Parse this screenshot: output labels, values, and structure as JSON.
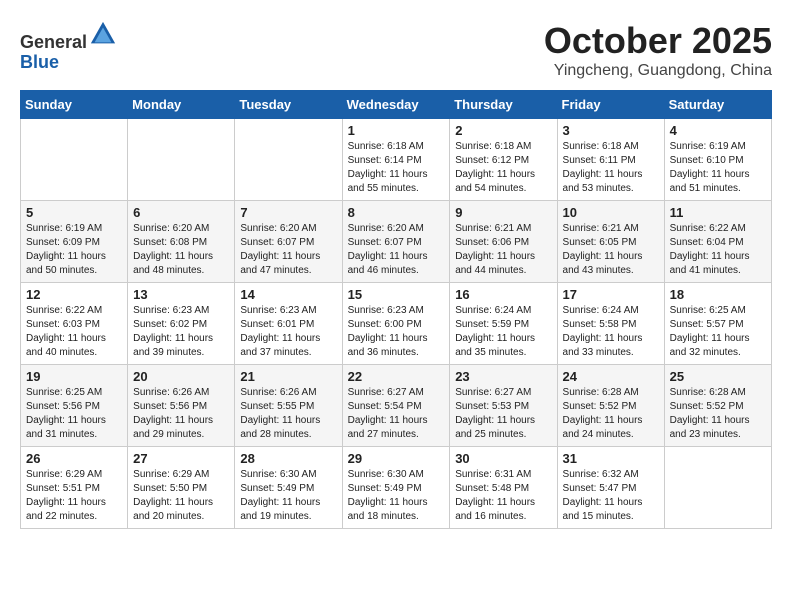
{
  "header": {
    "logo_line1": "General",
    "logo_line2": "Blue",
    "month": "October 2025",
    "location": "Yingcheng, Guangdong, China"
  },
  "weekdays": [
    "Sunday",
    "Monday",
    "Tuesday",
    "Wednesday",
    "Thursday",
    "Friday",
    "Saturday"
  ],
  "weeks": [
    [
      {
        "day": "",
        "info": ""
      },
      {
        "day": "",
        "info": ""
      },
      {
        "day": "",
        "info": ""
      },
      {
        "day": "1",
        "info": "Sunrise: 6:18 AM\nSunset: 6:14 PM\nDaylight: 11 hours\nand 55 minutes."
      },
      {
        "day": "2",
        "info": "Sunrise: 6:18 AM\nSunset: 6:12 PM\nDaylight: 11 hours\nand 54 minutes."
      },
      {
        "day": "3",
        "info": "Sunrise: 6:18 AM\nSunset: 6:11 PM\nDaylight: 11 hours\nand 53 minutes."
      },
      {
        "day": "4",
        "info": "Sunrise: 6:19 AM\nSunset: 6:10 PM\nDaylight: 11 hours\nand 51 minutes."
      }
    ],
    [
      {
        "day": "5",
        "info": "Sunrise: 6:19 AM\nSunset: 6:09 PM\nDaylight: 11 hours\nand 50 minutes."
      },
      {
        "day": "6",
        "info": "Sunrise: 6:20 AM\nSunset: 6:08 PM\nDaylight: 11 hours\nand 48 minutes."
      },
      {
        "day": "7",
        "info": "Sunrise: 6:20 AM\nSunset: 6:07 PM\nDaylight: 11 hours\nand 47 minutes."
      },
      {
        "day": "8",
        "info": "Sunrise: 6:20 AM\nSunset: 6:07 PM\nDaylight: 11 hours\nand 46 minutes."
      },
      {
        "day": "9",
        "info": "Sunrise: 6:21 AM\nSunset: 6:06 PM\nDaylight: 11 hours\nand 44 minutes."
      },
      {
        "day": "10",
        "info": "Sunrise: 6:21 AM\nSunset: 6:05 PM\nDaylight: 11 hours\nand 43 minutes."
      },
      {
        "day": "11",
        "info": "Sunrise: 6:22 AM\nSunset: 6:04 PM\nDaylight: 11 hours\nand 41 minutes."
      }
    ],
    [
      {
        "day": "12",
        "info": "Sunrise: 6:22 AM\nSunset: 6:03 PM\nDaylight: 11 hours\nand 40 minutes."
      },
      {
        "day": "13",
        "info": "Sunrise: 6:23 AM\nSunset: 6:02 PM\nDaylight: 11 hours\nand 39 minutes."
      },
      {
        "day": "14",
        "info": "Sunrise: 6:23 AM\nSunset: 6:01 PM\nDaylight: 11 hours\nand 37 minutes."
      },
      {
        "day": "15",
        "info": "Sunrise: 6:23 AM\nSunset: 6:00 PM\nDaylight: 11 hours\nand 36 minutes."
      },
      {
        "day": "16",
        "info": "Sunrise: 6:24 AM\nSunset: 5:59 PM\nDaylight: 11 hours\nand 35 minutes."
      },
      {
        "day": "17",
        "info": "Sunrise: 6:24 AM\nSunset: 5:58 PM\nDaylight: 11 hours\nand 33 minutes."
      },
      {
        "day": "18",
        "info": "Sunrise: 6:25 AM\nSunset: 5:57 PM\nDaylight: 11 hours\nand 32 minutes."
      }
    ],
    [
      {
        "day": "19",
        "info": "Sunrise: 6:25 AM\nSunset: 5:56 PM\nDaylight: 11 hours\nand 31 minutes."
      },
      {
        "day": "20",
        "info": "Sunrise: 6:26 AM\nSunset: 5:56 PM\nDaylight: 11 hours\nand 29 minutes."
      },
      {
        "day": "21",
        "info": "Sunrise: 6:26 AM\nSunset: 5:55 PM\nDaylight: 11 hours\nand 28 minutes."
      },
      {
        "day": "22",
        "info": "Sunrise: 6:27 AM\nSunset: 5:54 PM\nDaylight: 11 hours\nand 27 minutes."
      },
      {
        "day": "23",
        "info": "Sunrise: 6:27 AM\nSunset: 5:53 PM\nDaylight: 11 hours\nand 25 minutes."
      },
      {
        "day": "24",
        "info": "Sunrise: 6:28 AM\nSunset: 5:52 PM\nDaylight: 11 hours\nand 24 minutes."
      },
      {
        "day": "25",
        "info": "Sunrise: 6:28 AM\nSunset: 5:52 PM\nDaylight: 11 hours\nand 23 minutes."
      }
    ],
    [
      {
        "day": "26",
        "info": "Sunrise: 6:29 AM\nSunset: 5:51 PM\nDaylight: 11 hours\nand 22 minutes."
      },
      {
        "day": "27",
        "info": "Sunrise: 6:29 AM\nSunset: 5:50 PM\nDaylight: 11 hours\nand 20 minutes."
      },
      {
        "day": "28",
        "info": "Sunrise: 6:30 AM\nSunset: 5:49 PM\nDaylight: 11 hours\nand 19 minutes."
      },
      {
        "day": "29",
        "info": "Sunrise: 6:30 AM\nSunset: 5:49 PM\nDaylight: 11 hours\nand 18 minutes."
      },
      {
        "day": "30",
        "info": "Sunrise: 6:31 AM\nSunset: 5:48 PM\nDaylight: 11 hours\nand 16 minutes."
      },
      {
        "day": "31",
        "info": "Sunrise: 6:32 AM\nSunset: 5:47 PM\nDaylight: 11 hours\nand 15 minutes."
      },
      {
        "day": "",
        "info": ""
      }
    ]
  ]
}
